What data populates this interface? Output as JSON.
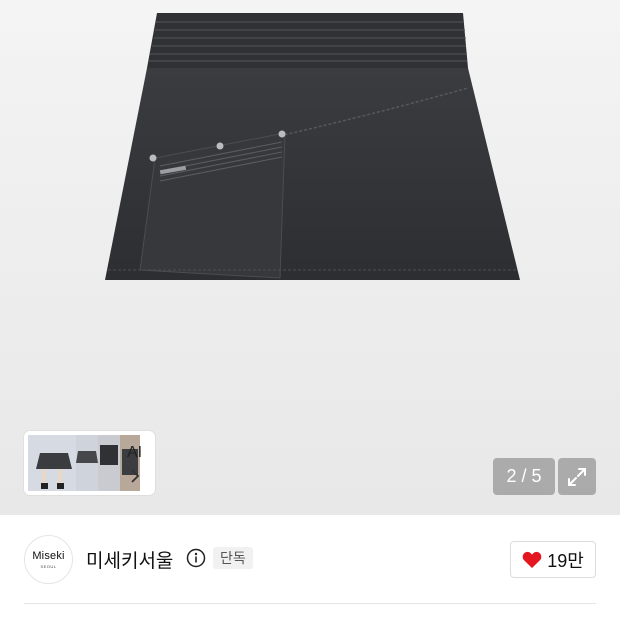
{
  "gallery": {
    "counter": "2 / 5",
    "ai_card": {
      "label": "AI"
    }
  },
  "brand": {
    "logo_text": "Miseki",
    "logo_subtext": "SEOUL",
    "name": "미세키서울",
    "badge": "단독",
    "likes": "19만"
  },
  "icons": {
    "info": "info-icon",
    "heart": "heart-icon",
    "expand": "expand-icon",
    "chevron": "chevron-right-icon"
  },
  "colors": {
    "heart": "#e4161f",
    "counter_bg": "#969696"
  }
}
